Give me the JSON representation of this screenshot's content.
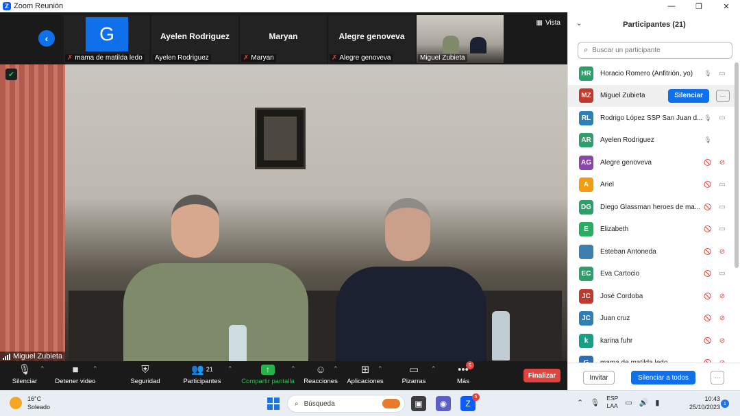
{
  "window": {
    "title": "Zoom Reunión",
    "minimize": "—",
    "maximize": "❐",
    "close": "✕"
  },
  "strip": {
    "view_label": "Vista",
    "thumbnails": [
      {
        "avatar_letter": "G",
        "name": "",
        "label": "mama de matilda ledo",
        "muted": true
      },
      {
        "avatar_letter": "",
        "name": "Ayelen Rodriguez",
        "label": "Ayelen Rodriguez",
        "muted": false
      },
      {
        "avatar_letter": "",
        "name": "Maryan",
        "label": "Maryan",
        "muted": true
      },
      {
        "avatar_letter": "",
        "name": "Alegre genoveva",
        "label": "Alegre genoveva",
        "muted": true
      },
      {
        "avatar_letter": "",
        "name": "",
        "label": "Miguel Zubieta",
        "muted": false
      }
    ]
  },
  "main_video": {
    "speaker_label": "Miguel Zubieta"
  },
  "toolbar": {
    "mute_label": "Silenciar",
    "video_label": "Detener video",
    "security_label": "Seguridad",
    "participants_label": "Participantes",
    "participants_count": "21",
    "share_label": "Compartir pantalla",
    "reactions_label": "Reacciones",
    "apps_label": "Aplicaciones",
    "whiteboards_label": "Pizarras",
    "more_label": "Más",
    "more_badge": "5",
    "end_label": "Finalizar"
  },
  "panel": {
    "title": "Participantes (21)",
    "search_placeholder": "Buscar un participante",
    "mute_button": "Silenciar",
    "more_button": "···",
    "participants": [
      {
        "initials": "HR",
        "name": "Horacio Romero (Anfitrión, yo)",
        "color": "#2e9e6a",
        "mic": "on",
        "cam": "on"
      },
      {
        "initials": "MZ",
        "name": "Miguel Zubieta",
        "color": "#c0392b",
        "mic": "hover",
        "cam": "hover"
      },
      {
        "initials": "RL",
        "name": "Rodrigo López SSP San Juan d...",
        "color": "#2c7fb8",
        "mic": "on",
        "cam": "on"
      },
      {
        "initials": "AR",
        "name": "Ayelen Rodriguez",
        "color": "#2e9e6a",
        "mic": "on",
        "cam": "none"
      },
      {
        "initials": "AG",
        "name": "Alegre genoveva",
        "color": "#8e44ad",
        "mic": "off",
        "cam": "off"
      },
      {
        "initials": "A",
        "name": "Ariel",
        "color": "#f39c12",
        "mic": "off",
        "cam": "on"
      },
      {
        "initials": "DG",
        "name": "Diego Glassman heroes de ma...",
        "color": "#2e9e6a",
        "mic": "off",
        "cam": "on"
      },
      {
        "initials": "E",
        "name": "Elizabeth",
        "color": "#27ae60",
        "mic": "off",
        "cam": "on"
      },
      {
        "initials": "",
        "name": "Esteban Antoneda",
        "color": "#3d7fb0",
        "mic": "off",
        "cam": "off"
      },
      {
        "initials": "EC",
        "name": "Eva Cartocio",
        "color": "#2e9e6a",
        "mic": "off",
        "cam": "on"
      },
      {
        "initials": "JC",
        "name": "José Cordoba",
        "color": "#c0392b",
        "mic": "off",
        "cam": "off"
      },
      {
        "initials": "JC",
        "name": "Juan cruz",
        "color": "#2c7fb8",
        "mic": "off",
        "cam": "off"
      },
      {
        "initials": "k",
        "name": "karina fuhr",
        "color": "#16a085",
        "mic": "off",
        "cam": "off"
      },
      {
        "initials": "G",
        "name": "mama de matilda ledo",
        "color": "#2c6db8",
        "mic": "off",
        "cam": "off"
      }
    ],
    "invite_label": "Invitar",
    "mute_all_label": "Silenciar a todos",
    "footer_more": "···"
  },
  "taskbar": {
    "temperature": "16°C",
    "weather_text": "Soleado",
    "search_placeholder": "Búsqueda",
    "zoom_badge": "5",
    "lang_top": "ESP",
    "lang_bottom": "LAA",
    "time": "10:43",
    "date": "25/10/2023",
    "notification_count": "1"
  }
}
